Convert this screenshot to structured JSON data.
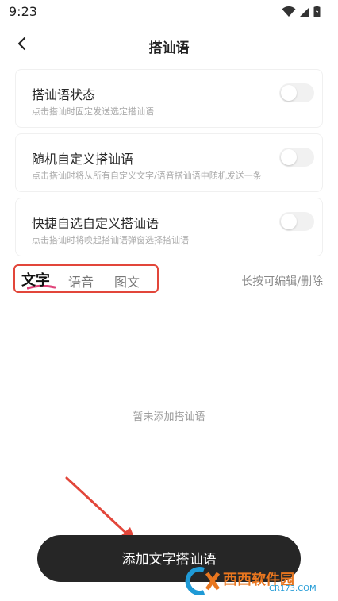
{
  "status_bar": {
    "time": "9:23"
  },
  "header": {
    "title": "搭讪语"
  },
  "settings": [
    {
      "title": "搭讪语状态",
      "subtitle": "点击搭讪时固定发送选定搭讪语",
      "enabled": false
    },
    {
      "title": "随机自定义搭讪语",
      "subtitle": "点击搭讪时将从所有自定义文字/语音搭讪语中随机发送一条",
      "enabled": false
    },
    {
      "title": "快捷自选自定义搭讪语",
      "subtitle": "点击搭讪时将唤起搭讪语弹窗选择搭讪语",
      "enabled": false
    }
  ],
  "tabs": [
    {
      "label": "文字",
      "active": true
    },
    {
      "label": "语音",
      "active": false
    },
    {
      "label": "图文",
      "active": false
    }
  ],
  "hint": "长按可编辑/删除",
  "empty_text": "暂未添加搭讪语",
  "add_button": {
    "label": "添加文字搭讪语"
  },
  "watermark": {
    "brand": "西西软件园",
    "url": "CR173.COM"
  },
  "colors": {
    "highlight_border": "#e2463a",
    "button_bg": "#262626",
    "tab_underline": "#e0447a"
  },
  "icons": {
    "back": "back-arrow-icon",
    "wifi": "wifi-icon",
    "signal": "signal-icon",
    "battery": "battery-icon"
  }
}
